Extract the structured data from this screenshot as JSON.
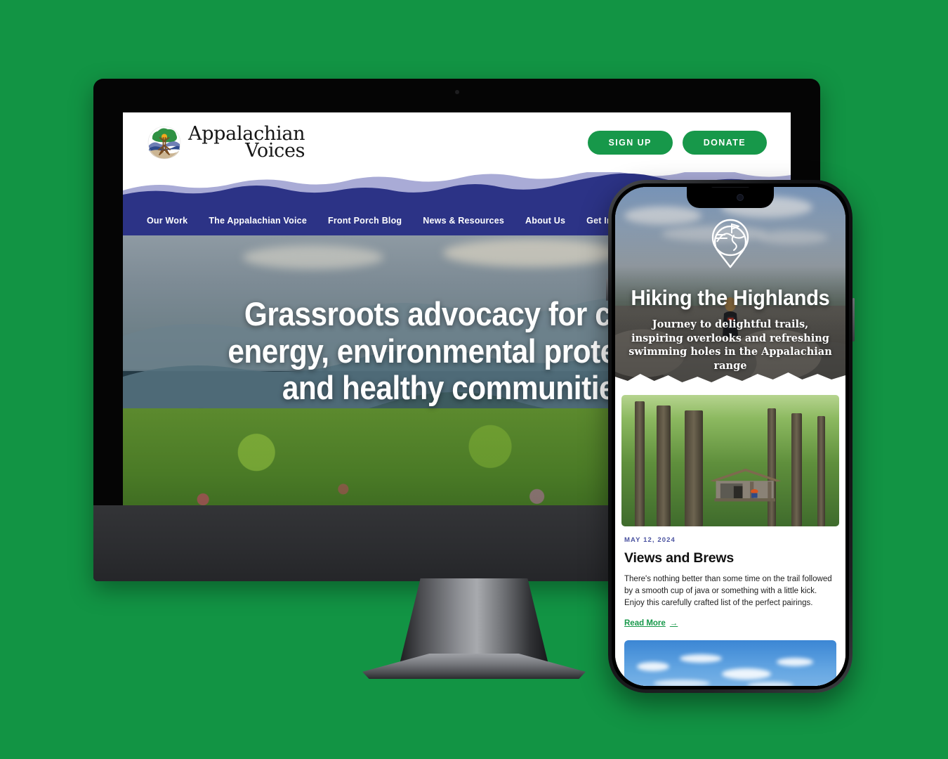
{
  "background_color": "#129444",
  "desktop": {
    "device": "imac-style-monitor",
    "site": {
      "brand": {
        "line1": "Appalachian",
        "line2": "Voices",
        "logo_icon": "tree-roots-mountain-logo"
      },
      "header_buttons": [
        {
          "label": "SIGN UP",
          "name": "sign-up-button",
          "color": "#17984a"
        },
        {
          "label": "DONATE",
          "name": "donate-button",
          "color": "#17984a"
        }
      ],
      "nav": {
        "background_color": "#2c3386",
        "items": [
          {
            "label": "Our Work"
          },
          {
            "label": "The Appalachian Voice"
          },
          {
            "label": "Front Porch Blog"
          },
          {
            "label": "News & Resources"
          },
          {
            "label": "About Us"
          },
          {
            "label": "Get Involved"
          }
        ],
        "search_icon": "search-icon"
      },
      "hero": {
        "headline_line1": "Grassroots advocacy for clean",
        "headline_line2": "energy, environmental protection",
        "headline_line3": "and healthy communities",
        "image_description": "blue-ridge-mountains-with-rhododendron"
      },
      "mountain_graphic": {
        "front_color": "#2c3386",
        "back_color": "#a9abd6"
      }
    }
  },
  "phone": {
    "device": "iphone-style-smartphone",
    "hero": {
      "badge_icon": "trail-map-badge-icon",
      "title": "Hiking the Highlands",
      "subtitle": "Journey to delightful trails, inspiring overlooks and refreshing swimming holes in the Appalachian range",
      "image_description": "hiker-seated-on-rocky-overlook"
    },
    "article": {
      "image_description": "forest-trail-shelter-cabin",
      "date": "MAY 12, 2024",
      "title": "Views and Brews",
      "body": "There's nothing better than some time on the trail followed by a smooth cup of java or something with a little kick. Enjoy this carefully crafted list of the perfect pairings.",
      "read_more_label": "Read More",
      "read_more_arrow": "→",
      "link_color": "#17984a",
      "date_color": "#4b53a0"
    },
    "next_card": {
      "image_description": "blue-sky-with-clouds"
    }
  }
}
